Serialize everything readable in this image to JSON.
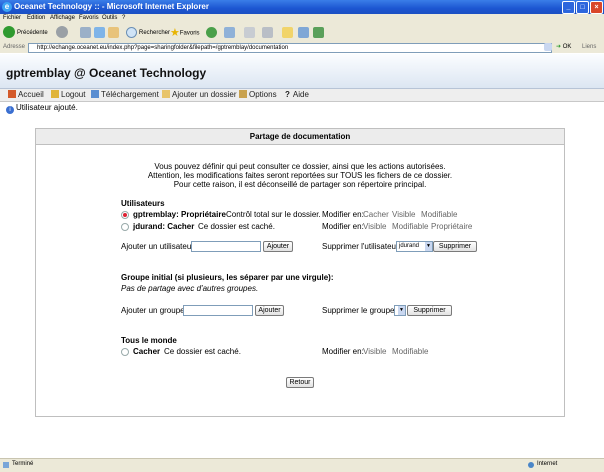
{
  "window": {
    "title": "Oceanet Technology :: - Microsoft Internet Explorer",
    "controls": [
      "_",
      "□",
      "×"
    ]
  },
  "menubar": [
    "Fichier",
    "Edition",
    "Affichage",
    "Favoris",
    "Outils",
    "?"
  ],
  "toolbar": {
    "back": "Précédente",
    "search": "Rechercher",
    "favorites": "Favoris"
  },
  "addressbar": {
    "label": "Adresse",
    "url": "http://echange.oceanet.eu/index.php?page=sharingfolder&filepath=/gptremblay/documentation",
    "go": "OK",
    "links": "Liens"
  },
  "site": {
    "title": "gptremblay @ Oceanet Technology"
  },
  "nav": [
    "Accueil",
    "Logout",
    "Téléchargement",
    "Ajouter un dossier",
    "Options",
    "Aide"
  ],
  "message": "Utilisateur ajouté.",
  "panel": {
    "title": "Partage de documentation",
    "intro": [
      "Vous pouvez définir qui peut consulter ce dossier, ainsi que les actions autorisées.",
      "Attention, les modifications faites seront reportées sur TOUS les fichers de ce dossier.",
      "Pour cette raison, il est déconseillé de partager son répertoire principal."
    ],
    "users": {
      "heading": "Utilisateurs",
      "rows": [
        {
          "name": "gptremblay: Propriétaire",
          "desc": "Contrôl total sur le dossier.",
          "modify_label": "Modifier en:",
          "options": [
            "Cacher",
            "Visible",
            "Modifiable"
          ]
        },
        {
          "name": "jdurand: Cacher",
          "desc": "Ce dossier est caché.",
          "modify_label": "Modifier en:",
          "options": [
            "Visible",
            "Modifiable",
            "Propriétaire"
          ]
        }
      ],
      "add_label": "Ajouter un utilisateur:",
      "add_button": "Ajouter",
      "remove_label": "Supprimer l'utilisateur:",
      "remove_selected": "jdurand",
      "remove_button": "Supprimer"
    },
    "groups": {
      "heading": "Groupe initial (si plusieurs, les séparer par une virgule):",
      "note": "Pas de partage avec d'autres groupes.",
      "add_label": "Ajouter un groupe:",
      "add_button": "Ajouter",
      "remove_label": "Supprimer le groupe:",
      "remove_button": "Supprimer"
    },
    "everyone": {
      "heading": "Tous le monde",
      "name": "Cacher",
      "desc": "Ce dossier est caché.",
      "modify_label": "Modifier en:",
      "options": [
        "Visible",
        "Modifiable"
      ]
    },
    "back_button": "Retour"
  },
  "statusbar": {
    "left": "Terminé",
    "zone": "Internet"
  },
  "colors": {
    "titlebar": "#1c56d1",
    "link_gray": "#666666",
    "radio_selected": "#dd2233"
  }
}
